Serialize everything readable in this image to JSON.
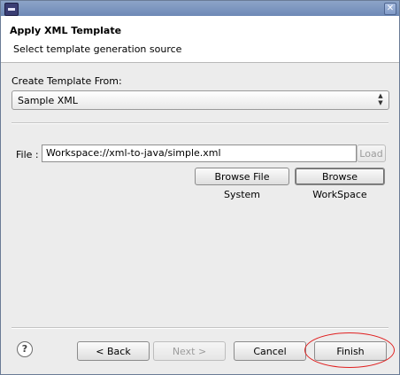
{
  "window": {
    "title_icon": "eclipse-app-icon",
    "close_icon": "close-icon"
  },
  "header": {
    "title": "Apply XML Template",
    "description": "Select template generation source"
  },
  "source": {
    "label": "Create Template From:",
    "selected": "Sample XML"
  },
  "file": {
    "label": "File :",
    "value": "Workspace://xml-to-java/simple.xml",
    "load_label": "Load",
    "browse_fs_label": "Browse File System",
    "browse_ws_label": "Browse WorkSpace"
  },
  "footer": {
    "help_symbol": "?",
    "back_label": "< Back",
    "next_label": "Next >",
    "cancel_label": "Cancel",
    "finish_label": "Finish"
  },
  "colors": {
    "titlebar": "#6d89b6",
    "annotation": "#e02020"
  }
}
